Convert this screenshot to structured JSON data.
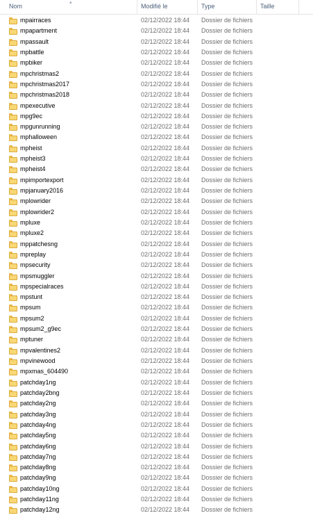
{
  "header": {
    "name": "Nom",
    "modified": "Modifié le",
    "type": "Type",
    "size": "Taille"
  },
  "rows": [
    {
      "name": "mpairraces",
      "date": "02/12/2022 18:44",
      "type": "Dossier de fichiers"
    },
    {
      "name": "mpapartment",
      "date": "02/12/2022 18:44",
      "type": "Dossier de fichiers"
    },
    {
      "name": "mpassault",
      "date": "02/12/2022 18:44",
      "type": "Dossier de fichiers"
    },
    {
      "name": "mpbattle",
      "date": "02/12/2022 18:44",
      "type": "Dossier de fichiers"
    },
    {
      "name": "mpbiker",
      "date": "02/12/2022 18:44",
      "type": "Dossier de fichiers"
    },
    {
      "name": "mpchristmas2",
      "date": "02/12/2022 18:44",
      "type": "Dossier de fichiers"
    },
    {
      "name": "mpchristmas2017",
      "date": "02/12/2022 18:44",
      "type": "Dossier de fichiers"
    },
    {
      "name": "mpchristmas2018",
      "date": "02/12/2022 18:44",
      "type": "Dossier de fichiers"
    },
    {
      "name": "mpexecutive",
      "date": "02/12/2022 18:44",
      "type": "Dossier de fichiers"
    },
    {
      "name": "mpg9ec",
      "date": "02/12/2022 18:44",
      "type": "Dossier de fichiers"
    },
    {
      "name": "mpgunrunning",
      "date": "02/12/2022 18:44",
      "type": "Dossier de fichiers"
    },
    {
      "name": "mphalloween",
      "date": "02/12/2022 18:44",
      "type": "Dossier de fichiers"
    },
    {
      "name": "mpheist",
      "date": "02/12/2022 18:44",
      "type": "Dossier de fichiers"
    },
    {
      "name": "mpheist3",
      "date": "02/12/2022 18:44",
      "type": "Dossier de fichiers"
    },
    {
      "name": "mpheist4",
      "date": "02/12/2022 18:44",
      "type": "Dossier de fichiers"
    },
    {
      "name": "mpimportexport",
      "date": "02/12/2022 18:44",
      "type": "Dossier de fichiers"
    },
    {
      "name": "mpjanuary2016",
      "date": "02/12/2022 18:44",
      "type": "Dossier de fichiers"
    },
    {
      "name": "mplowrider",
      "date": "02/12/2022 18:44",
      "type": "Dossier de fichiers"
    },
    {
      "name": "mplowrider2",
      "date": "02/12/2022 18:44",
      "type": "Dossier de fichiers"
    },
    {
      "name": "mpluxe",
      "date": "02/12/2022 18:44",
      "type": "Dossier de fichiers"
    },
    {
      "name": "mpluxe2",
      "date": "02/12/2022 18:44",
      "type": "Dossier de fichiers"
    },
    {
      "name": "mppatchesng",
      "date": "02/12/2022 18:44",
      "type": "Dossier de fichiers"
    },
    {
      "name": "mpreplay",
      "date": "02/12/2022 18:44",
      "type": "Dossier de fichiers"
    },
    {
      "name": "mpsecurity",
      "date": "02/12/2022 18:44",
      "type": "Dossier de fichiers"
    },
    {
      "name": "mpsmuggler",
      "date": "02/12/2022 18:44",
      "type": "Dossier de fichiers"
    },
    {
      "name": "mpspecialraces",
      "date": "02/12/2022 18:44",
      "type": "Dossier de fichiers"
    },
    {
      "name": "mpstunt",
      "date": "02/12/2022 18:44",
      "type": "Dossier de fichiers"
    },
    {
      "name": "mpsum",
      "date": "02/12/2022 18:44",
      "type": "Dossier de fichiers"
    },
    {
      "name": "mpsum2",
      "date": "02/12/2022 18:44",
      "type": "Dossier de fichiers"
    },
    {
      "name": "mpsum2_g9ec",
      "date": "02/12/2022 18:44",
      "type": "Dossier de fichiers"
    },
    {
      "name": "mptuner",
      "date": "02/12/2022 18:44",
      "type": "Dossier de fichiers"
    },
    {
      "name": "mpvalentines2",
      "date": "02/12/2022 18:44",
      "type": "Dossier de fichiers"
    },
    {
      "name": "mpvinewood",
      "date": "02/12/2022 18:44",
      "type": "Dossier de fichiers"
    },
    {
      "name": "mpxmas_604490",
      "date": "02/12/2022 18:44",
      "type": "Dossier de fichiers"
    },
    {
      "name": "patchday1ng",
      "date": "02/12/2022 18:44",
      "type": "Dossier de fichiers"
    },
    {
      "name": "patchday2bng",
      "date": "02/12/2022 18:44",
      "type": "Dossier de fichiers"
    },
    {
      "name": "patchday2ng",
      "date": "02/12/2022 18:44",
      "type": "Dossier de fichiers"
    },
    {
      "name": "patchday3ng",
      "date": "02/12/2022 18:44",
      "type": "Dossier de fichiers"
    },
    {
      "name": "patchday4ng",
      "date": "02/12/2022 18:44",
      "type": "Dossier de fichiers"
    },
    {
      "name": "patchday5ng",
      "date": "02/12/2022 18:44",
      "type": "Dossier de fichiers"
    },
    {
      "name": "patchday6ng",
      "date": "02/12/2022 18:44",
      "type": "Dossier de fichiers"
    },
    {
      "name": "patchday7ng",
      "date": "02/12/2022 18:44",
      "type": "Dossier de fichiers"
    },
    {
      "name": "patchday8ng",
      "date": "02/12/2022 18:44",
      "type": "Dossier de fichiers"
    },
    {
      "name": "patchday9ng",
      "date": "02/12/2022 18:44",
      "type": "Dossier de fichiers"
    },
    {
      "name": "patchday10ng",
      "date": "02/12/2022 18:44",
      "type": "Dossier de fichiers"
    },
    {
      "name": "patchday11ng",
      "date": "02/12/2022 18:44",
      "type": "Dossier de fichiers"
    },
    {
      "name": "patchday12ng",
      "date": "02/12/2022 18:44",
      "type": "Dossier de fichiers"
    }
  ],
  "colors": {
    "header_text": "#4c607a",
    "folder_fill": "#f8d775",
    "folder_border": "#dcaa3a",
    "secondary_text": "#6d6d6d"
  }
}
